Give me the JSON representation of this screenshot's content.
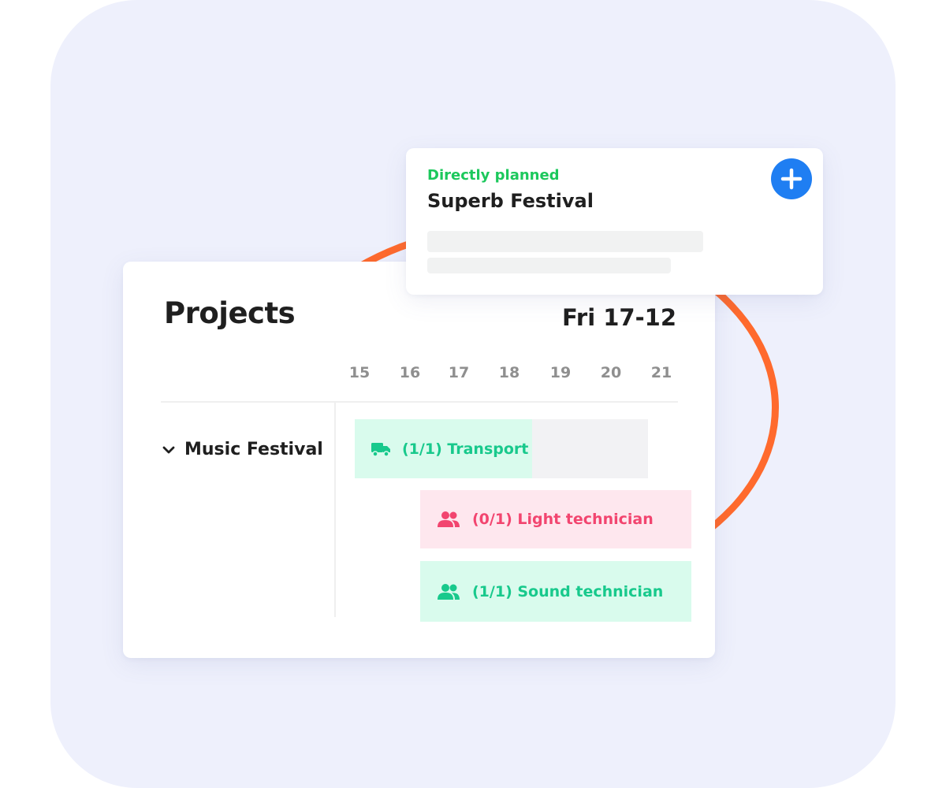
{
  "colors": {
    "background_panel": "#eef0fc",
    "ring": "#ff6a2d",
    "success_green": "#18c98c",
    "success_bg": "#d9fbed",
    "danger_pink": "#f2456f",
    "danger_bg": "#fee7ee",
    "status_green": "#1cc85c",
    "accent_blue": "#1f7ef2"
  },
  "popup": {
    "status": "Directly planned",
    "title": "Superb Festival",
    "add_icon": "plus-icon"
  },
  "projects": {
    "title": "Projects",
    "date": "Fri 17-12",
    "days": [
      "15",
      "16",
      "17",
      "18",
      "19",
      "20",
      "21"
    ],
    "group": {
      "label": "Music Festival",
      "icon": "chevron-down-icon"
    },
    "assignments": [
      {
        "label": "(1/1) Transport",
        "icon": "truck-icon",
        "status": "filled"
      },
      {
        "label": "(0/1) Light technician",
        "icon": "people-icon",
        "status": "unfilled"
      },
      {
        "label": "(1/1) Sound technician",
        "icon": "people-icon",
        "status": "filled"
      }
    ]
  }
}
